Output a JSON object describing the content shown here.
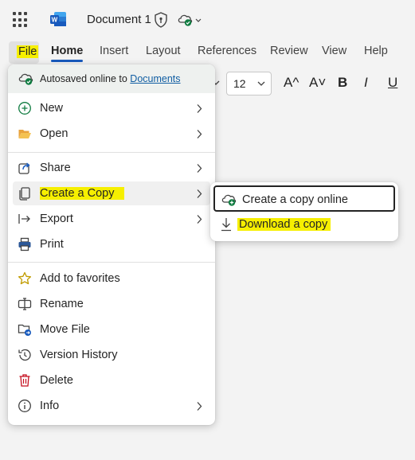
{
  "app": {
    "title": "Document 1",
    "icons": [
      "app-launcher-icon",
      "word-logo-icon",
      "sensitivity-shield-icon",
      "cloud-saved-icon"
    ]
  },
  "ribbon": {
    "tabs": [
      {
        "label": "File"
      },
      {
        "label": "Home"
      },
      {
        "label": "Insert"
      },
      {
        "label": "Layout"
      },
      {
        "label": "References"
      },
      {
        "label": "Review"
      },
      {
        "label": "View"
      },
      {
        "label": "Help"
      }
    ],
    "font_size": "12",
    "tools": [
      "A^",
      "A˅",
      "B",
      "I",
      "U"
    ]
  },
  "file_menu": {
    "autosave_text": "Autosaved online to",
    "autosave_link": "Documents",
    "items": [
      {
        "label": "New",
        "icon": "plus-circle-icon",
        "has_submenu": true
      },
      {
        "label": "Open",
        "icon": "folder-open-icon",
        "has_submenu": true
      },
      {
        "label": "Share",
        "icon": "share-icon",
        "has_submenu": true
      },
      {
        "label": "Create a Copy",
        "icon": "copy-icon",
        "has_submenu": true
      },
      {
        "label": "Export",
        "icon": "export-icon",
        "has_submenu": true
      },
      {
        "label": "Print",
        "icon": "print-icon",
        "has_submenu": false
      },
      {
        "label": "Add to favorites",
        "icon": "star-icon",
        "has_submenu": false
      },
      {
        "label": "Rename",
        "icon": "rename-icon",
        "has_submenu": false
      },
      {
        "label": "Move File",
        "icon": "move-file-icon",
        "has_submenu": false
      },
      {
        "label": "Version History",
        "icon": "history-icon",
        "has_submenu": false
      },
      {
        "label": "Delete",
        "icon": "trash-icon",
        "has_submenu": false
      },
      {
        "label": "Info",
        "icon": "info-icon",
        "has_submenu": true
      }
    ]
  },
  "submenu": {
    "items": [
      {
        "label": "Create a copy online",
        "icon": "cloud-add-icon"
      },
      {
        "label": "Download a copy",
        "icon": "download-icon"
      }
    ]
  },
  "colors": {
    "accent": "#185abd",
    "highlight": "#f6ef00",
    "link": "#115ea3",
    "delete": "#c50f1f",
    "saved": "#107c41"
  }
}
